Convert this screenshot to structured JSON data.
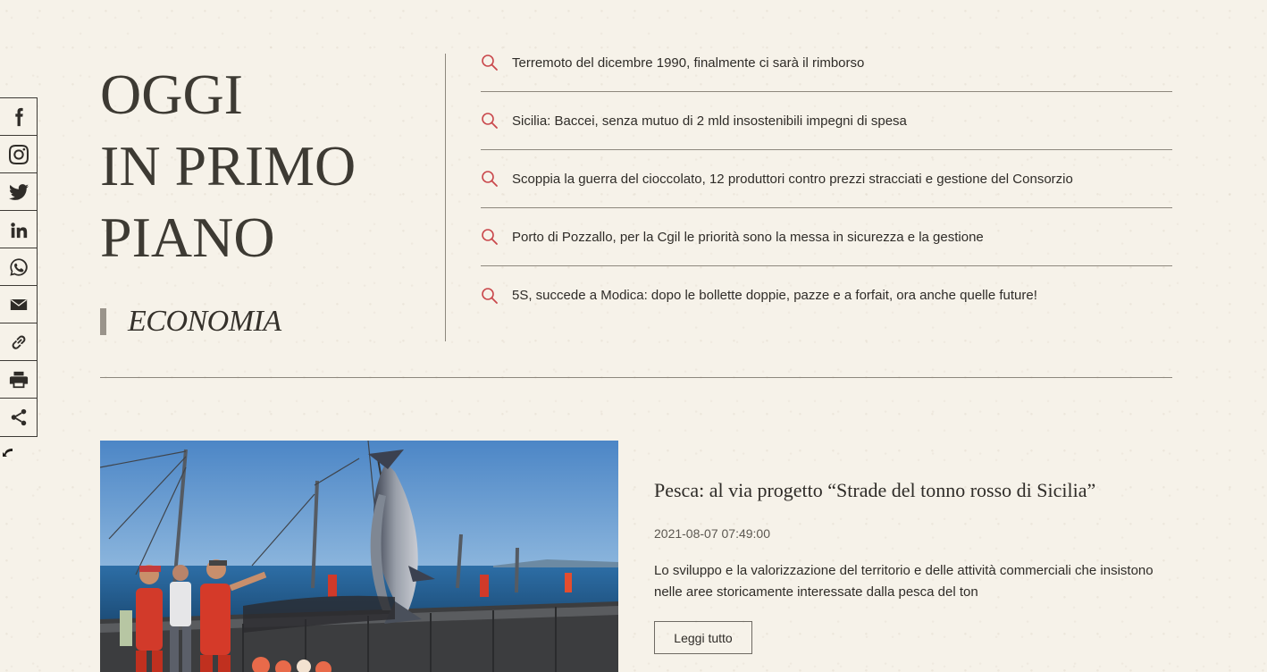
{
  "hero": {
    "title_lines": [
      "OGGI",
      "IN PRIMO",
      "PIANO"
    ],
    "category": "ECONOMIA"
  },
  "headlines": [
    "Terremoto del dicembre 1990, finalmente ci sarà il rimborso",
    "Sicilia: Baccei, senza mutuo di 2 mld insostenibili impegni di spesa",
    "Scoppia la guerra del cioccolato, 12 produttori contro prezzi stracciati e gestione del Consorzio",
    "Porto di Pozzallo, per la Cgil le priorità sono la messa in sicurezza e la gestione",
    "5S, succede a Modica: dopo le bollette doppie, pazze e a forfait, ora anche quelle future!"
  ],
  "article": {
    "title": "Pesca: al via progetto “Strade del tonno rosso di Sicilia”",
    "date": "2021-08-07 07:49:00",
    "excerpt": "Lo sviluppo e la valorizzazione del territorio e delle attività commerciali che insistono nelle aree storicamente interessate dalla pesca del ton",
    "read_more": "Leggi tutto"
  },
  "social_icons": [
    "facebook-icon",
    "instagram-icon",
    "twitter-icon",
    "linkedin-icon",
    "whatsapp-icon",
    "email-icon",
    "link-icon",
    "print-icon",
    "share-icon"
  ],
  "colors": {
    "background": "#f6f2e9",
    "search_icon": "#c9474b",
    "text": "#2f2c28",
    "divider": "#8d877d"
  }
}
